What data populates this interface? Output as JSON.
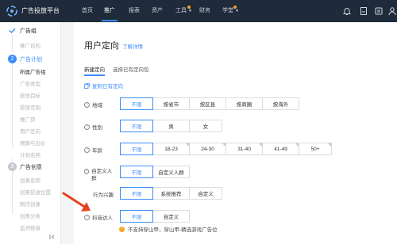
{
  "topbar": {
    "brand": "广告投放平台",
    "nav": [
      {
        "label": "首页"
      },
      {
        "label": "推广"
      },
      {
        "label": "报表"
      },
      {
        "label": "资产"
      },
      {
        "label": "工具"
      },
      {
        "label": "财务"
      },
      {
        "label": "学堂"
      }
    ],
    "icons": [
      "bell-icon",
      "document-icon",
      "list-icon",
      "user-icon"
    ],
    "colors": {
      "bar": "#1f2b3a",
      "accent": "#3a8cff",
      "dot": "#f5a623"
    }
  },
  "sidebar": {
    "steps": [
      {
        "badge": "",
        "label": "广告组",
        "subs": [
          "推广目的"
        ]
      },
      {
        "badge": "2",
        "label": "广告计划",
        "subs": [
          "所属广告组",
          "广告类型",
          "投放目标",
          "投放范围",
          "推广页",
          "用户定向",
          "预算与出价",
          "计划名称"
        ]
      },
      {
        "badge": "3",
        "label": "广告创意",
        "subs": [
          "创意名称",
          "创意投放位置",
          "制作创意",
          "创意分类",
          "监测链接"
        ]
      }
    ]
  },
  "main": {
    "title": "用户定向",
    "detail_link": "了解详情",
    "tabs": [
      "新建定向",
      "选择已有定向包"
    ],
    "copy_link": "复制已有定向",
    "rows": [
      {
        "label": "地域",
        "options": [
          "不限",
          "按省市",
          "按区县",
          "按商圈",
          "按海外"
        ],
        "selected": 0
      },
      {
        "label": "性别",
        "options": [
          "不限",
          "男",
          "女"
        ],
        "selected": 0
      },
      {
        "label": "年龄",
        "options": [
          "不限",
          "18-23",
          "24-30",
          "31-40",
          "41-49",
          "50+"
        ],
        "selected": 0
      },
      {
        "label": "自定义人群",
        "options": [
          "不限",
          "自定义人群"
        ],
        "selected": 0
      },
      {
        "label": "行为兴趣",
        "options": [
          "不限",
          "系统推荐",
          "自定义"
        ],
        "selected": 0
      },
      {
        "label": "抖音达人",
        "options": [
          "不限",
          "自定义"
        ],
        "selected": 0
      }
    ],
    "warning": "不支持穿山甲，穿山甲-精选游戏广告位"
  }
}
